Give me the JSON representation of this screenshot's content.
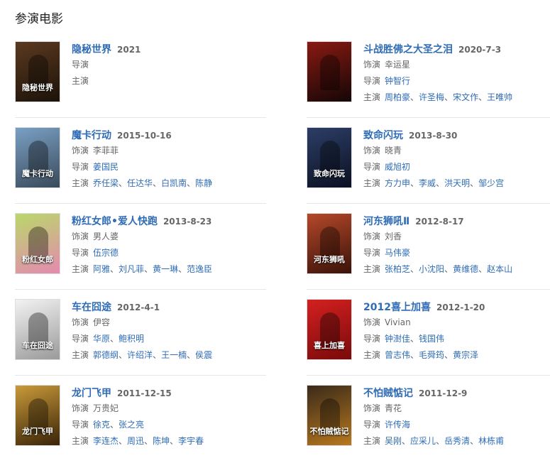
{
  "section_title": "参演电影",
  "labels": {
    "role": "饰演",
    "director": "导演",
    "cast": "主演",
    "sep": "、"
  },
  "films": [
    {
      "title": "隐秘世界",
      "date": "2021",
      "poster": {
        "bg1": "#5b3a1f",
        "bg2": "#1c120a",
        "text": "隐秘世界"
      },
      "role": null,
      "directors": [],
      "cast": []
    },
    {
      "title": "斗战胜佛之大圣之泪",
      "date": "2020-7-3",
      "poster": {
        "bg1": "#8a1a12",
        "bg2": "#140606",
        "text": ""
      },
      "role": "幸运星",
      "directors": [
        "钟智行"
      ],
      "cast": [
        "周柏豪",
        "许圣梅",
        "宋文作",
        "王唯帅"
      ]
    },
    {
      "title": "魔卡行动",
      "date": "2015-10-16",
      "poster": {
        "bg1": "#7aa0c4",
        "bg2": "#3a4a5a",
        "text": "魔卡行动"
      },
      "role": "李菲菲",
      "directors": [
        "姜国民"
      ],
      "cast": [
        "乔任梁",
        "任达华",
        "白凯南",
        "陈静"
      ]
    },
    {
      "title": "致命闪玩",
      "date": "2013-8-30",
      "poster": {
        "bg1": "#2c3e66",
        "bg2": "#0b1022",
        "text": "致命闪玩"
      },
      "role": "晓青",
      "directors": [
        "威旭初"
      ],
      "cast": [
        "方力申",
        "李威",
        "洪天明",
        "邹少宫"
      ]
    },
    {
      "title": "粉红女郎•爱人快跑",
      "date": "2013-8-23",
      "poster": {
        "bg1": "#b9d86a",
        "bg2": "#e48ab0",
        "text": "粉红女郎"
      },
      "role": "男人婆",
      "directors": [
        "伍宗德"
      ],
      "cast": [
        "阿雅",
        "刘凡菲",
        "黄一琳",
        "范逸臣"
      ]
    },
    {
      "title": "河东狮吼Ⅱ",
      "date": "2012-8-17",
      "poster": {
        "bg1": "#b5482a",
        "bg2": "#3a1208",
        "text": "河东狮吼"
      },
      "role": "刘香",
      "directors": [
        "马伟豪"
      ],
      "cast": [
        "张柏芝",
        "小沈阳",
        "黄维德",
        "赵本山"
      ]
    },
    {
      "title": "车在囧途",
      "date": "2012-4-1",
      "poster": {
        "bg1": "#f2f2f2",
        "bg2": "#9a9a9a",
        "text": "车在囧途"
      },
      "role": "伊容",
      "directors": [
        "华原",
        "鲍积明"
      ],
      "cast": [
        "郭德纲",
        "许绍洋",
        "王一楠",
        "侯震"
      ]
    },
    {
      "title": "2012喜上加喜",
      "date": "2012-1-20",
      "poster": {
        "bg1": "#d42020",
        "bg2": "#7a0a0a",
        "text": "喜上加喜"
      },
      "role": "Vivian",
      "directors": [
        "钟澍佳",
        "钱国伟"
      ],
      "cast": [
        "曾志伟",
        "毛舜筠",
        "黄宗泽"
      ]
    },
    {
      "title": "龙门飞甲",
      "date": "2011-12-15",
      "poster": {
        "bg1": "#c99a3a",
        "bg2": "#3a2408",
        "text": "龙门飞甲"
      },
      "role": "万贵妃",
      "directors": [
        "徐克",
        "张之亮"
      ],
      "cast": [
        "李连杰",
        "周迅",
        "陈坤",
        "李宇春"
      ]
    },
    {
      "title": "不怕贼惦记",
      "date": "2011-12-9",
      "poster": {
        "bg1": "#3a2a1a",
        "bg2": "#b8781e",
        "text": "不怕贼惦记"
      },
      "role": "青花",
      "directors": [
        "许传海"
      ],
      "cast": [
        "吴刚",
        "应采儿",
        "岳秀清",
        "林栋甫"
      ]
    }
  ]
}
